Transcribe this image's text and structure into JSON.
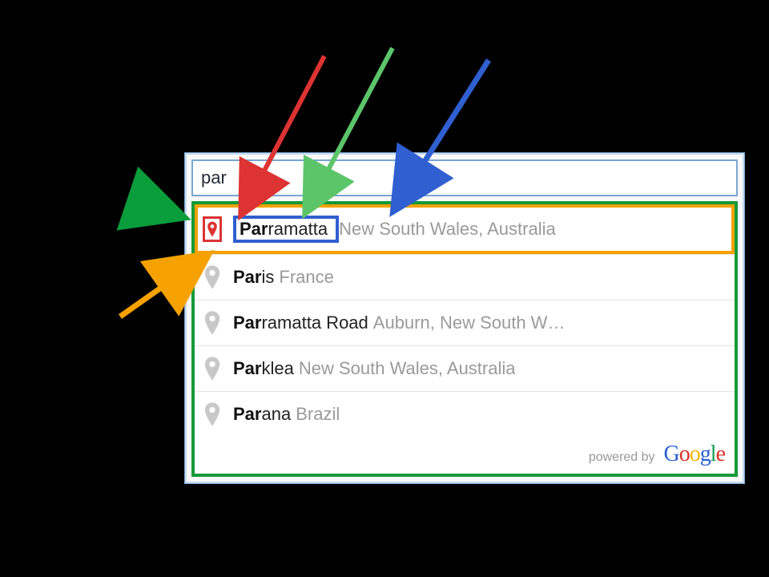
{
  "search": {
    "value": "par"
  },
  "results": [
    {
      "matched": "Par",
      "rest_primary": "ramatta",
      "secondary": "New South Wales, Australia"
    },
    {
      "matched": "Par",
      "rest_primary": "is",
      "secondary": "France"
    },
    {
      "matched": "Par",
      "rest_primary": "ramatta Road",
      "secondary": "Auburn, New South W…"
    },
    {
      "matched": "Par",
      "rest_primary": "klea",
      "secondary": "New South Wales, Australia"
    },
    {
      "matched": "Par",
      "rest_primary": "ana",
      "secondary": "Brazil"
    }
  ],
  "footer": {
    "powered_by": "powered by",
    "logo_letters": [
      "G",
      "o",
      "o",
      "g",
      "l",
      "e"
    ]
  },
  "callouts": [
    {
      "name": "green-outer-arrow",
      "color": "#0a9d3b"
    },
    {
      "name": "red-arrow",
      "color": "#d33"
    },
    {
      "name": "mid-green-arrow",
      "color": "#5cc56a"
    },
    {
      "name": "blue-arrow",
      "color": "#2f5fd0"
    },
    {
      "name": "yellow-arrow",
      "color": "#f5a100"
    }
  ]
}
